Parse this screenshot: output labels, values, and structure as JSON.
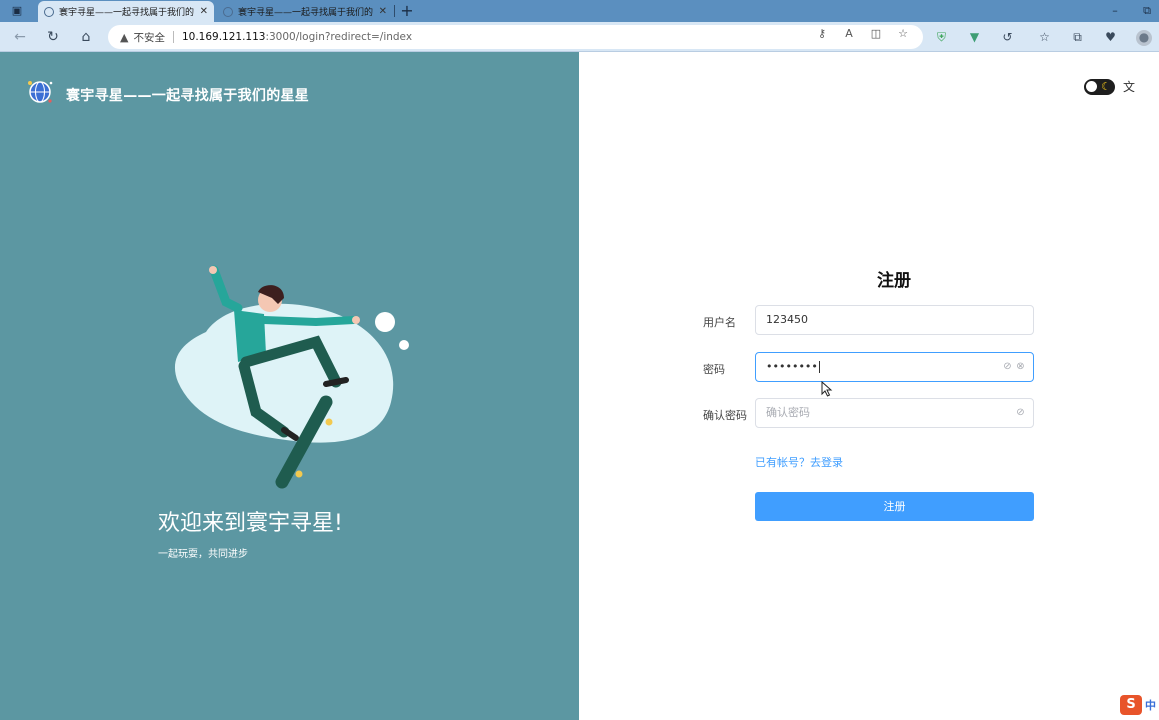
{
  "browser": {
    "tabs": [
      {
        "title": "寰宇寻星——一起寻找属于我们的",
        "active": true
      },
      {
        "title": "寰宇寻星——一起寻找属于我们的",
        "active": false
      }
    ],
    "address": {
      "security_label": "不安全",
      "host": "10.169.121.113",
      "path": ":3000/login?redirect=/index"
    }
  },
  "left": {
    "brand": "寰宇寻星——一起寻找属于我们的星星",
    "welcome": "欢迎来到寰宇寻星!",
    "tagline": "一起玩耍，共同进步"
  },
  "form": {
    "title": "注册",
    "username_label": "用户名",
    "username_value": "123450",
    "password_label": "密码",
    "password_value": "••••••••",
    "confirm_label": "确认密码",
    "confirm_placeholder": "确认密码",
    "login_link": "已有帐号？去登录",
    "submit_label": "注册"
  },
  "ime": {
    "label": "中"
  },
  "colors": {
    "left_panel": "#5c97a2",
    "primary": "#409eff",
    "tabstrip": "#5b8fbf",
    "toolbar": "#d8e7f5"
  }
}
